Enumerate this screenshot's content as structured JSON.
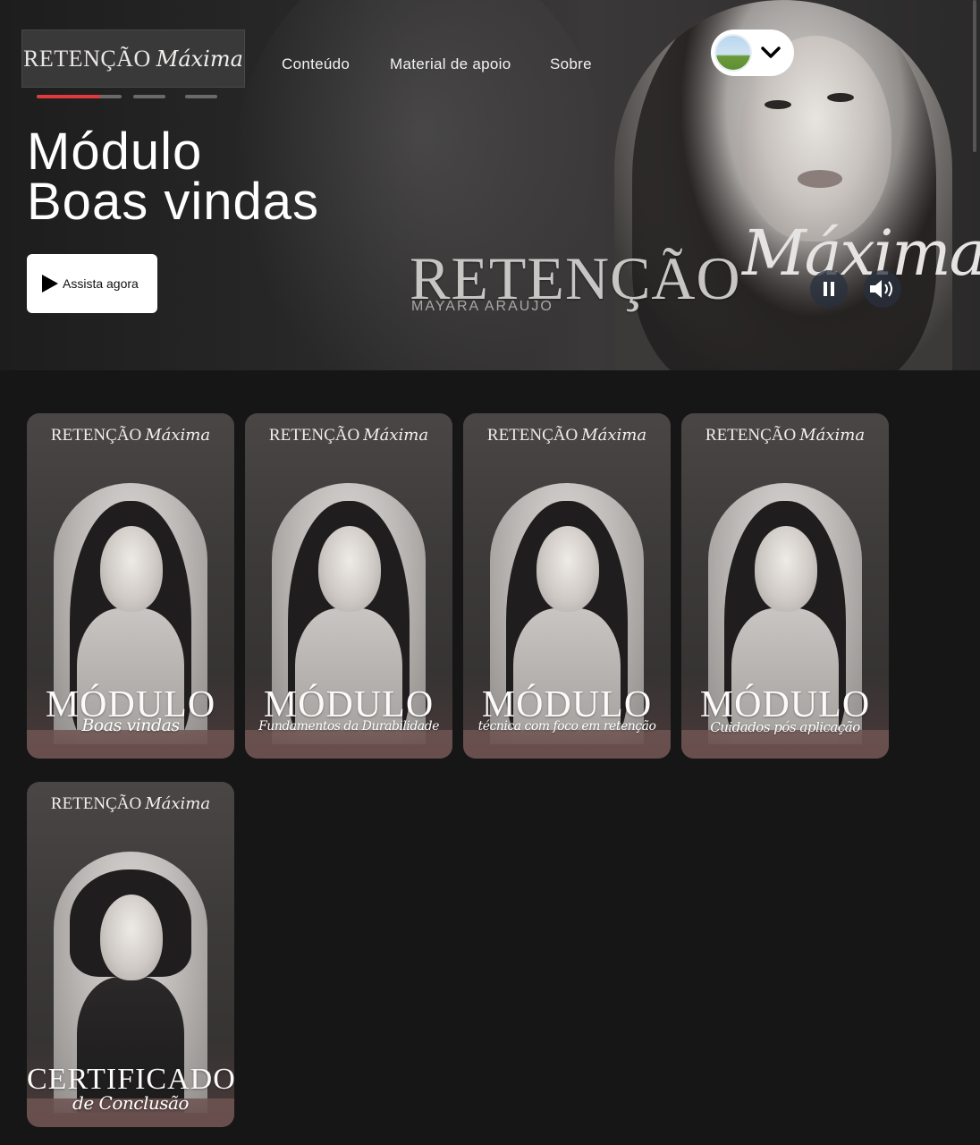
{
  "header": {
    "logo": {
      "serif": "RETENÇÃO",
      "script": "Máxima"
    },
    "nav": [
      "Conteúdo",
      "Material de apoio",
      "Sobre"
    ],
    "progress": [
      {
        "fraction": 0.75
      },
      {
        "fraction": 0
      },
      {
        "fraction": 0
      }
    ]
  },
  "hero": {
    "title_line1": "Módulo",
    "title_line2": "Boas vindas",
    "watch_label": "Assista agora",
    "brand_serif": "RETENÇÃO",
    "brand_script": "Máxima",
    "brand_sub": "MAYARA ARAUJO"
  },
  "cards": [
    {
      "brand_serif": "RETENÇÃO",
      "brand_script": "Máxima",
      "title": "MÓDULO",
      "subtitle": "Boas vindas"
    },
    {
      "brand_serif": "RETENÇÃO",
      "brand_script": "Máxima",
      "title": "MÓDULO",
      "subtitle": "Fundamentos da Durabilidade"
    },
    {
      "brand_serif": "RETENÇÃO",
      "brand_script": "Máxima",
      "title": "MÓDULO",
      "subtitle": "técnica com foco em retenção"
    },
    {
      "brand_serif": "RETENÇÃO",
      "brand_script": "Máxima",
      "title": "MÓDULO",
      "subtitle": "Cuidados pós aplicação"
    },
    {
      "brand_serif": "RETENÇÃO",
      "brand_script": "Máxima",
      "title": "CERTIFICADO",
      "subtitle": "de Conclusão"
    }
  ],
  "icons": {
    "play": "play-icon",
    "pause": "pause-icon",
    "volume": "volume-icon",
    "chevron": "chevron-down-icon"
  },
  "colors": {
    "background": "#161616",
    "progress_active": "#e0393e",
    "button_bg": "#ffffff"
  }
}
